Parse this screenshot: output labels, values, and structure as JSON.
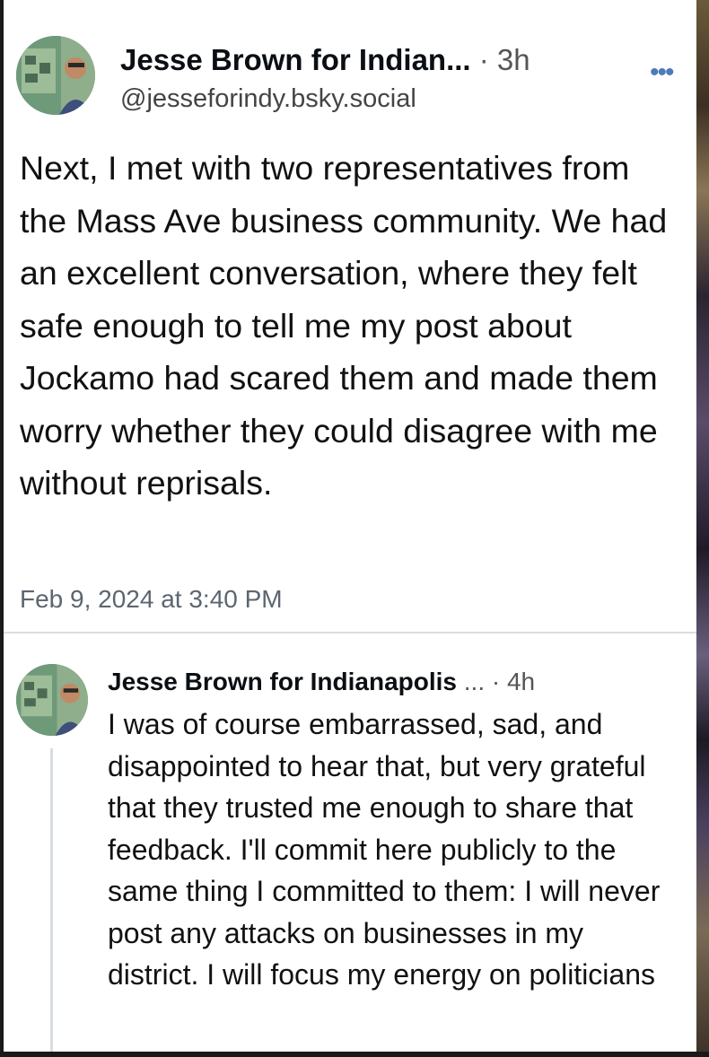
{
  "post": {
    "display_name": "Jesse Brown for Indian...",
    "meta": "· 3h",
    "handle": "@jesseforindy.bsky.social",
    "more_icon": "ellipsis-icon",
    "more_label": "•••",
    "text": "Next, I met with two representatives from the Mass Ave business community.  We had an excellent conversation, where they felt safe enough to tell me my post about Jockamo had scared them and made them worry whether they could disagree with me without reprisals.",
    "timestamp": "Feb 9, 2024 at 3:40 PM"
  },
  "reply": {
    "display_name": "Jesse Brown for Indianapolis",
    "meta": " ... · 4h",
    "text": "I was of course embarrassed, sad, and disappointed to hear that, but very grateful that they trusted me enough to share that feedback.  I'll commit here publicly to the same thing I committed to them: I will never post any attacks on businesses in my district.  I will focus my energy on politicians"
  },
  "colors": {
    "accent": "#4d7ab8",
    "muted_text": "#5c6670",
    "divider": "#d8dde2"
  }
}
